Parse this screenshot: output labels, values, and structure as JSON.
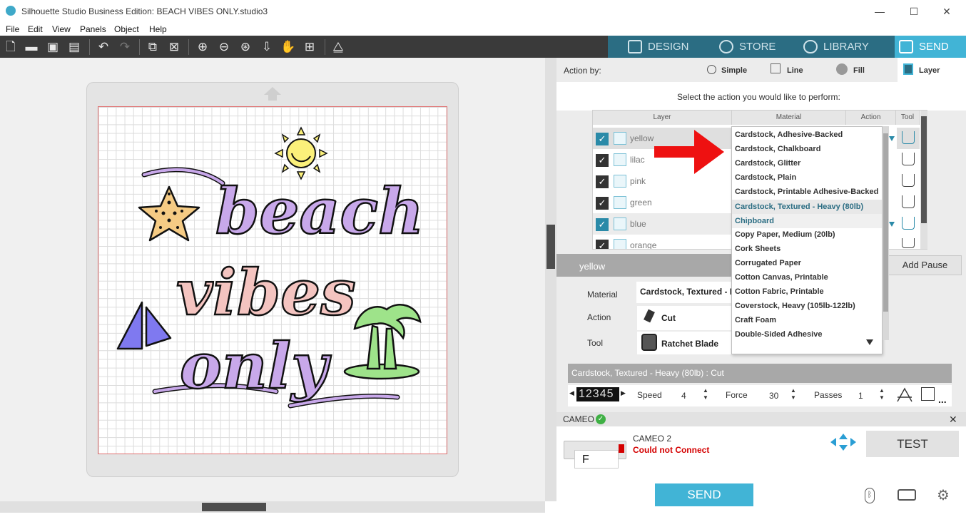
{
  "window": {
    "title": "Silhouette Studio Business Edition: BEACH VIBES ONLY.studio3",
    "minimize": "—",
    "maximize": "☐",
    "close": "✕"
  },
  "menu": [
    "File",
    "Edit",
    "View",
    "Panels",
    "Object",
    "Help"
  ],
  "tabs": [
    {
      "label": "DESIGN",
      "active": false
    },
    {
      "label": "STORE",
      "active": false
    },
    {
      "label": "LIBRARY",
      "active": false
    },
    {
      "label": "SEND",
      "active": true
    }
  ],
  "action_by": {
    "label": "Action by:",
    "options": [
      "Simple",
      "Line",
      "Fill",
      "Layer"
    ],
    "selected": "Layer"
  },
  "instruction": "Select the action you would like to perform:",
  "table": {
    "headers": [
      "Layer",
      "Material",
      "Action",
      "Tool"
    ],
    "rows": [
      {
        "name": "yellow",
        "checked_style": "blue"
      },
      {
        "name": "lilac",
        "checked_style": "dark"
      },
      {
        "name": "pink",
        "checked_style": "dark"
      },
      {
        "name": "green",
        "checked_style": "dark"
      },
      {
        "name": "blue",
        "checked_style": "blue"
      },
      {
        "name": "orange",
        "checked_style": "dark"
      }
    ]
  },
  "material_dropdown": {
    "items": [
      "Cardstock, Adhesive-Backed",
      "Cardstock, Chalkboard",
      "Cardstock, Glitter",
      "Cardstock, Plain",
      "Cardstock, Printable Adhesive-Backed",
      "Cardstock, Textured - Heavy (80lb)",
      "Chipboard",
      "Copy Paper, Medium (20lb)",
      "Cork Sheets",
      "Corrugated Paper",
      "Cotton Canvas, Printable",
      "Cotton Fabric, Printable",
      "Coverstock, Heavy (105lb-122lb)",
      "Craft Foam",
      "Double-Sided Adhesive"
    ],
    "selected": "Cardstock, Textured - Heavy (80lb)",
    "hovered": "Chipboard"
  },
  "selected_layer": {
    "name": "yellow",
    "add_pause": "Add Pause",
    "material_label": "Material",
    "material_value": "Cardstock, Textured - H",
    "action_label": "Action",
    "action_value": "Cut",
    "tool_label": "Tool",
    "tool_value": "Ratchet Blade"
  },
  "cut_settings": {
    "summary": "Cardstock, Textured - Heavy (80lb) : Cut",
    "blade_digits": "12345",
    "speed_label": "Speed",
    "speed": "4",
    "force_label": "Force",
    "force": "30",
    "passes_label": "Passes",
    "passes": "1",
    "more": "..."
  },
  "device": {
    "header": "CAMEO",
    "name": "CAMEO 2",
    "status": "Could not Connect",
    "status_color": "#d40000",
    "test": "TEST",
    "send": "SEND",
    "preview_letter": "F"
  },
  "design": {
    "words": [
      "beach",
      "vibes",
      "only"
    ],
    "colors": {
      "lilac": "#c8a8ea",
      "pink": "#f4c4c0",
      "yellow": "#fbf07a",
      "green": "#9ee38a",
      "blue": "#7f79f0",
      "orange": "#f5cb84"
    }
  },
  "accent": "#41b4d6"
}
